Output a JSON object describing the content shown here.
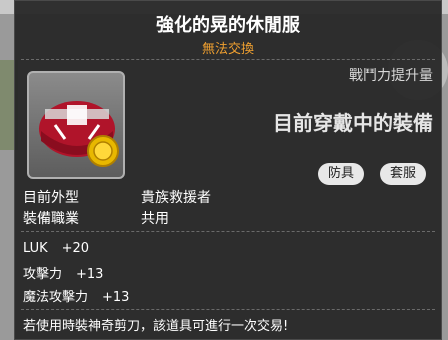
{
  "item": {
    "name": "強化的晃的休閒服",
    "trade_status": "無法交換",
    "power_label": "戰鬥力提升量",
    "equipped_label": "目前穿戴中的裝備",
    "tags": {
      "armor": "防具",
      "set": "套服"
    },
    "appearance_label": "目前外型",
    "appearance_value": "貴族救援者",
    "job_label": "裝備職業",
    "job_value": "共用"
  },
  "stats": [
    {
      "label": "LUK",
      "value": "+20"
    },
    {
      "label": "攻擊力",
      "value": "+13"
    },
    {
      "label": "魔法攻擊力",
      "value": "+13"
    }
  ],
  "note": "若使用時裝神奇剪刀，該道具可進行一次交易!",
  "colors": {
    "title": "#ffffff",
    "trade_status": "#f0a030",
    "tooltip_bg": "#262626"
  },
  "icons": {
    "item": "red-hat-icon",
    "coin": "gold-coin-icon"
  }
}
